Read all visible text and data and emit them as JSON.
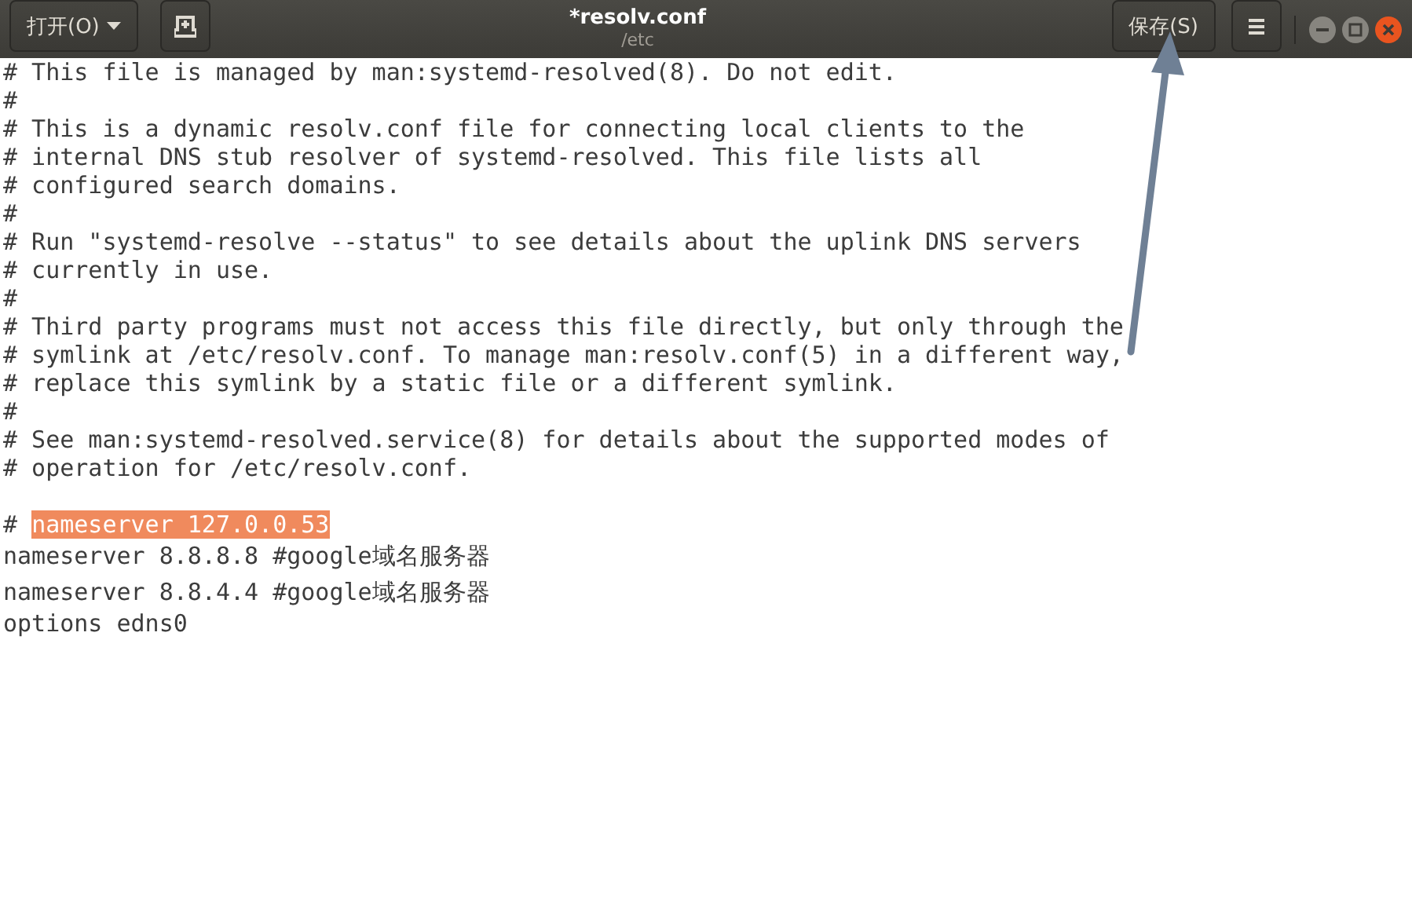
{
  "window": {
    "title": "*resolv.conf",
    "subtitle": "/etc"
  },
  "header": {
    "open_button": "打开(O)",
    "save_button": "保存(S)"
  },
  "editor": {
    "lines": [
      {
        "kind": "plain",
        "text": "# This file is managed by man:systemd-resolved(8). Do not edit."
      },
      {
        "kind": "plain",
        "text": "#"
      },
      {
        "kind": "plain",
        "text": "# This is a dynamic resolv.conf file for connecting local clients to the"
      },
      {
        "kind": "plain",
        "text": "# internal DNS stub resolver of systemd-resolved. This file lists all"
      },
      {
        "kind": "plain",
        "text": "# configured search domains."
      },
      {
        "kind": "plain",
        "text": "#"
      },
      {
        "kind": "plain",
        "text": "# Run \"systemd-resolve --status\" to see details about the uplink DNS servers"
      },
      {
        "kind": "plain",
        "text": "# currently in use."
      },
      {
        "kind": "plain",
        "text": "#"
      },
      {
        "kind": "plain",
        "text": "# Third party programs must not access this file directly, but only through the"
      },
      {
        "kind": "plain",
        "text": "# symlink at /etc/resolv.conf. To manage man:resolv.conf(5) in a different way,"
      },
      {
        "kind": "plain",
        "text": "# replace this symlink by a static file or a different symlink."
      },
      {
        "kind": "plain",
        "text": "#"
      },
      {
        "kind": "plain",
        "text": "# See man:systemd-resolved.service(8) for details about the supported modes of"
      },
      {
        "kind": "plain",
        "text": "# operation for /etc/resolv.conf."
      },
      {
        "kind": "blank"
      },
      {
        "kind": "selection",
        "text": "# ",
        "selected_text": "nameserver 127.0.0.53"
      },
      {
        "kind": "plain",
        "text": "nameserver 8.8.8.8 #google域名服务器"
      },
      {
        "kind": "plain",
        "text": "nameserver 8.8.4.4 #google域名服务器"
      },
      {
        "kind": "plain",
        "text": "options edns0"
      }
    ]
  }
}
